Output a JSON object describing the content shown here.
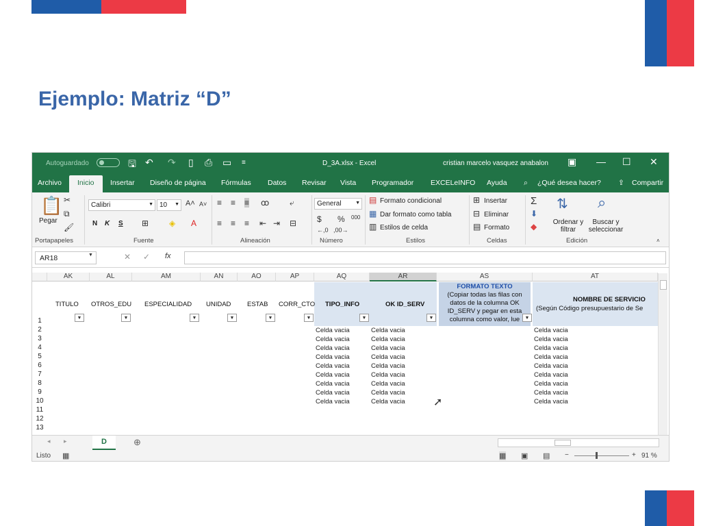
{
  "slide": {
    "title": "Ejemplo: Matriz “D”"
  },
  "titlebar": {
    "autosave": "Autoguardado",
    "filename": "D_3A.xlsx  -  Excel",
    "user": "cristian marcelo vasquez anabalon"
  },
  "tabs": [
    "Archivo",
    "Inicio",
    "Insertar",
    "Diseño de página",
    "Fórmulas",
    "Datos",
    "Revisar",
    "Vista",
    "Programador",
    "EXCELeINFO",
    "Ayuda"
  ],
  "active_tab": "Inicio",
  "tell_me": "¿Qué desea hacer?",
  "share": "Compartir",
  "ribbon": {
    "paste": "Pegar",
    "font_name": "Calibri",
    "font_size": "10",
    "bold": "N",
    "italic": "K",
    "underline": "S",
    "number_format": "General",
    "conditional_format": "Formato condicional",
    "format_as_table": "Dar formato como tabla",
    "cell_styles": "Estilos de celda",
    "insert": "Insertar",
    "delete": "Eliminar",
    "format": "Formato",
    "sort_filter": "Ordenar y filtrar",
    "find_select": "Buscar y seleccionar",
    "groups": [
      "Portapapeles",
      "Fuente",
      "Alineación",
      "Número",
      "Estilos",
      "Celdas",
      "Edición"
    ]
  },
  "formula_bar": {
    "name_box": "AR18",
    "fx": "fx"
  },
  "columns": [
    "AK",
    "AL",
    "AM",
    "AN",
    "AO",
    "AP",
    "AQ",
    "AR",
    "AS",
    "AT"
  ],
  "headers": {
    "titulo": "TITULO",
    "otros_edu": "OTROS_EDU",
    "especialidad": "ESPECIALIDAD",
    "unidad": "UNIDAD",
    "estab": "ESTAB",
    "corr_cto": "CORR_CTO",
    "tipo_info": "TIPO_INFO",
    "ok_id_serv": "OK ID_SERV",
    "formato_texto": "FORMATO TEXTO",
    "formato_texto_note": "(Copiar todas las filas con datos de la columna OK ID_SERV y pegar en esta columna como valor, lue",
    "nombre_servicio": "NOMBRE DE SERVICIO",
    "nombre_servicio_note": "(Según Código presupuestario de Se"
  },
  "rows": [
    "1",
    "2",
    "3",
    "4",
    "5",
    "6",
    "7",
    "8",
    "9",
    "10",
    "11",
    "12",
    "13"
  ],
  "empty_cell_text": "Celda vacia",
  "sheet": {
    "name": "D"
  },
  "status": {
    "ready": "Listo",
    "zoom": "91 %"
  }
}
